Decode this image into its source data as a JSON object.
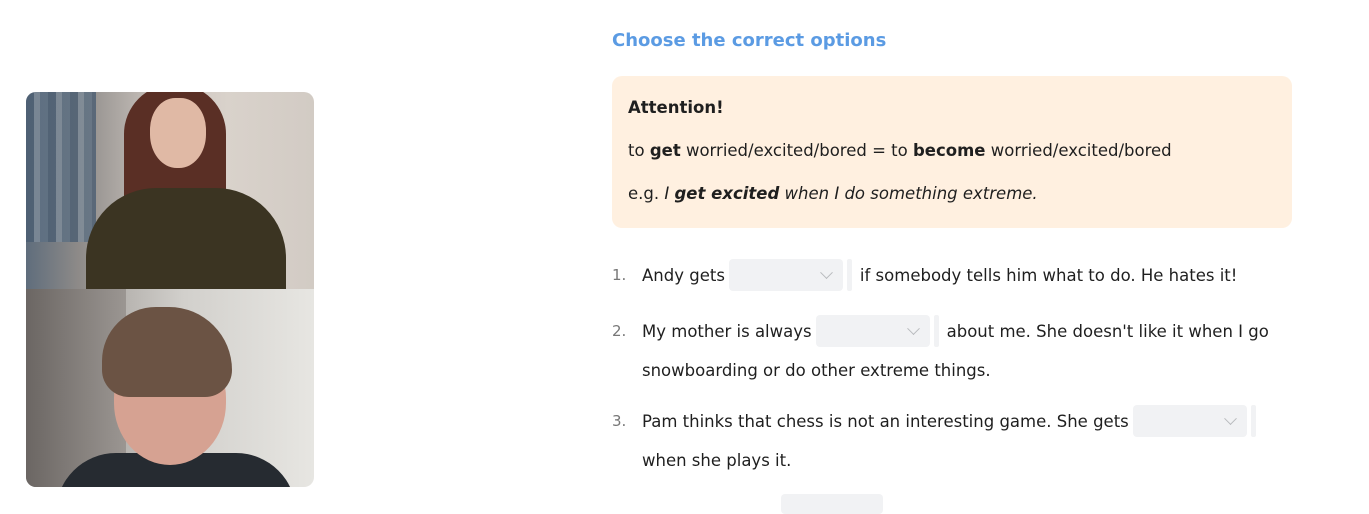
{
  "exercise": {
    "title": "Choose the correct options",
    "attention": {
      "heading": "Attention!",
      "rule_pre": "to ",
      "rule_get": "get",
      "rule_mid": " worried/excited/bored = to ",
      "rule_become": "become",
      "rule_post": " worried/excited/bored",
      "example_prefix": "e.g. ",
      "example_i": "I ",
      "example_bold": "get excited",
      "example_rest": " when I do something extreme."
    },
    "items": [
      {
        "number": "1.",
        "before": "Andy gets",
        "after": "if somebody tells him what to do. He hates it!",
        "selected": ""
      },
      {
        "number": "2.",
        "before": "My mother is always",
        "after": "about me. She doesn't like it when I go",
        "continuation": "snowboarding or do other extreme things.",
        "selected": ""
      },
      {
        "number": "3.",
        "before": "Pam thinks that chess is not an interesting game. She gets",
        "after": "",
        "continuation": "when she plays it.",
        "selected": ""
      }
    ]
  },
  "video_call": {
    "participants": [
      "participant-1",
      "participant-2"
    ]
  },
  "colors": {
    "title": "#5b9be3",
    "attention_bg": "#fff0e0",
    "select_bg": "#f1f2f4"
  }
}
